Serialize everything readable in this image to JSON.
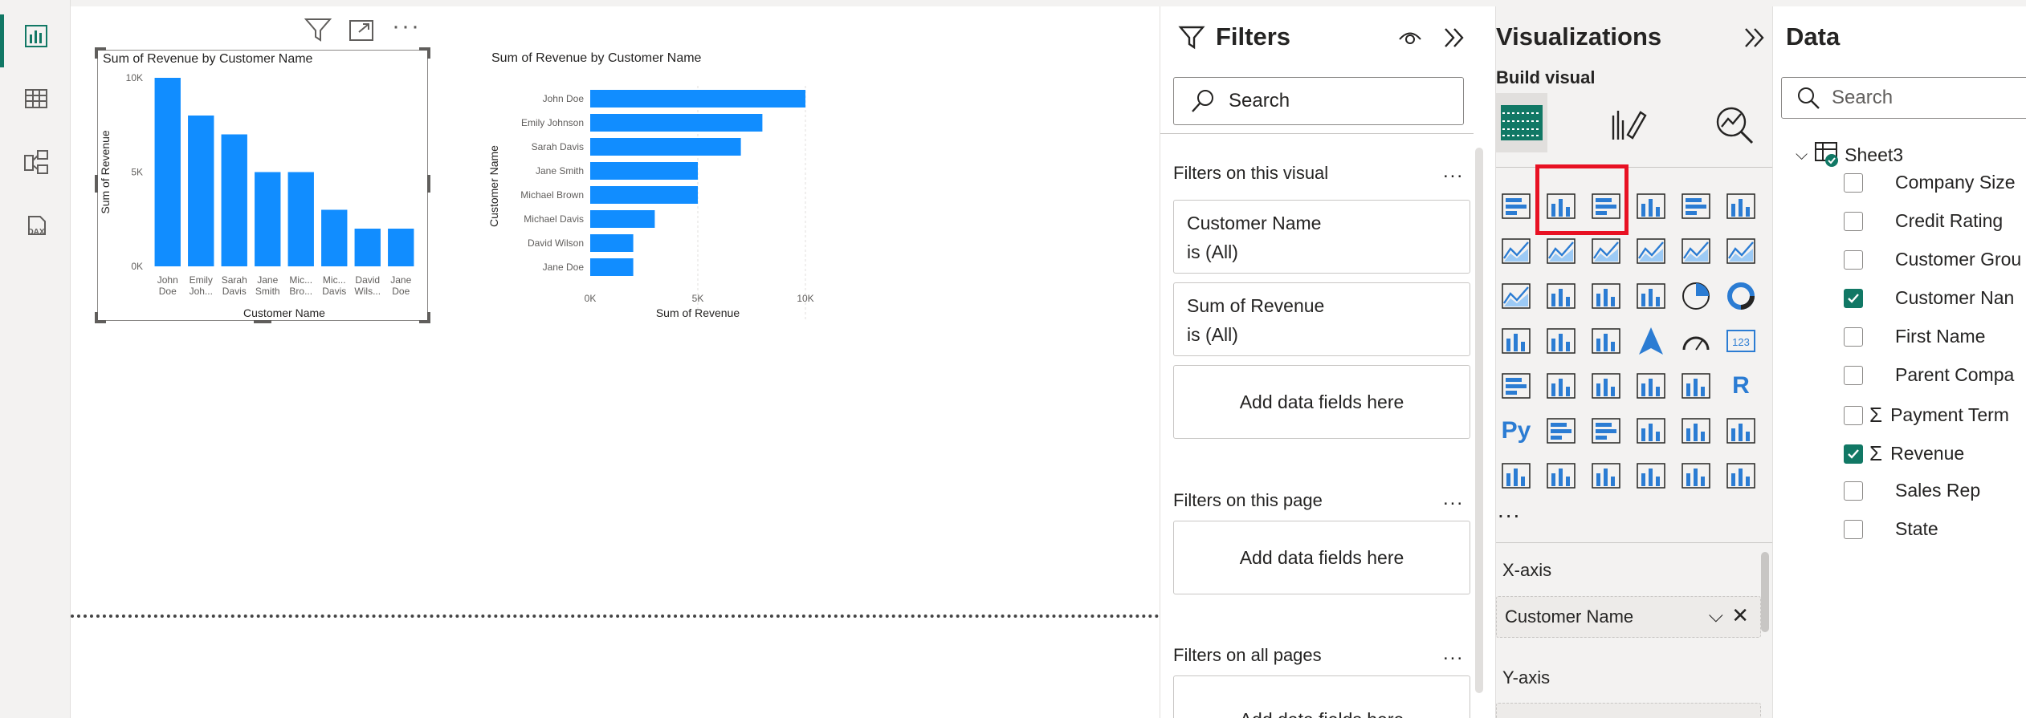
{
  "rail": {
    "icons": [
      "report-view-icon",
      "table-view-icon",
      "model-view-icon",
      "dax-query-icon"
    ],
    "dax_label": "DAX"
  },
  "visual1": {
    "title": "Sum of Revenue by Customer Name",
    "header_icons": [
      "filter-icon",
      "focus-mode-icon",
      "more-options-icon"
    ]
  },
  "visual2": {
    "title": "Sum of Revenue by Customer Name"
  },
  "chart_data": [
    {
      "type": "bar",
      "orientation": "vertical",
      "title": "Sum of Revenue by Customer Name",
      "xlabel": "Customer Name",
      "ylabel": "Sum of Revenue",
      "ylim": [
        0,
        10000
      ],
      "yticks": [
        "0K",
        "5K",
        "10K"
      ],
      "categories": [
        "John Doe",
        "Emily Johnson",
        "Sarah Davis",
        "Jane Smith",
        "Michael Brown",
        "Michael Davis",
        "David Wilson",
        "Jane Doe"
      ],
      "category_tick_labels": [
        [
          "John",
          "Doe"
        ],
        [
          "Emily",
          "Joh..."
        ],
        [
          "Sarah",
          "Davis"
        ],
        [
          "Jane",
          "Smith"
        ],
        [
          "Mic...",
          "Bro..."
        ],
        [
          "Mic...",
          "Davis"
        ],
        [
          "David",
          "Wils..."
        ],
        [
          "Jane",
          "Doe"
        ]
      ],
      "values": [
        10000,
        8000,
        7000,
        5000,
        5000,
        3000,
        2000,
        2000
      ],
      "color": "#118DFF"
    },
    {
      "type": "bar",
      "orientation": "horizontal",
      "title": "Sum of Revenue by Customer Name",
      "xlabel": "Sum of Revenue",
      "ylabel": "Customer Name",
      "xlim": [
        0,
        10000
      ],
      "xticks": [
        "0K",
        "5K",
        "10K"
      ],
      "categories": [
        "John Doe",
        "Emily Johnson",
        "Sarah Davis",
        "Jane Smith",
        "Michael Brown",
        "Michael Davis",
        "David Wilson",
        "Jane Doe"
      ],
      "values": [
        10000,
        8000,
        7000,
        5000,
        5000,
        3000,
        2000,
        2000
      ],
      "color": "#118DFF"
    }
  ],
  "filters": {
    "title": "Filters",
    "search_placeholder": "Search",
    "on_visual": "Filters on this visual",
    "cards": [
      {
        "line1": "Customer Name",
        "line2": "is (All)"
      },
      {
        "line1": "Sum of Revenue",
        "line2": "is (All)"
      }
    ],
    "add_fields": "Add data fields here",
    "on_page": "Filters on this page",
    "on_all": "Filters on all pages",
    "ellipsis": "..."
  },
  "viz": {
    "title": "Visualizations",
    "build_visual": "Build visual",
    "more": "...",
    "x_axis": "X-axis",
    "x_field": "Customer Name",
    "y_axis": "Y-axis",
    "r_label": "R",
    "py_label": "Py",
    "kpi_label": "123"
  },
  "data": {
    "title": "Data",
    "search_placeholder": "Search",
    "table": "Sheet3",
    "fields": [
      {
        "name": "Company Size",
        "checked": false,
        "sigma": false
      },
      {
        "name": "Credit Rating",
        "checked": false,
        "sigma": false
      },
      {
        "name": "Customer Grou",
        "checked": false,
        "sigma": false
      },
      {
        "name": "Customer Nan",
        "checked": true,
        "sigma": false
      },
      {
        "name": "First Name",
        "checked": false,
        "sigma": false
      },
      {
        "name": "Parent Compa",
        "checked": false,
        "sigma": false
      },
      {
        "name": "Payment Term",
        "checked": false,
        "sigma": true
      },
      {
        "name": "Revenue",
        "checked": true,
        "sigma": true
      },
      {
        "name": "Sales Rep",
        "checked": false,
        "sigma": false
      },
      {
        "name": "State",
        "checked": false,
        "sigma": false
      }
    ]
  },
  "colors": {
    "accent": "#117865",
    "bar": "#118DFF",
    "highlight": "#e81123"
  }
}
